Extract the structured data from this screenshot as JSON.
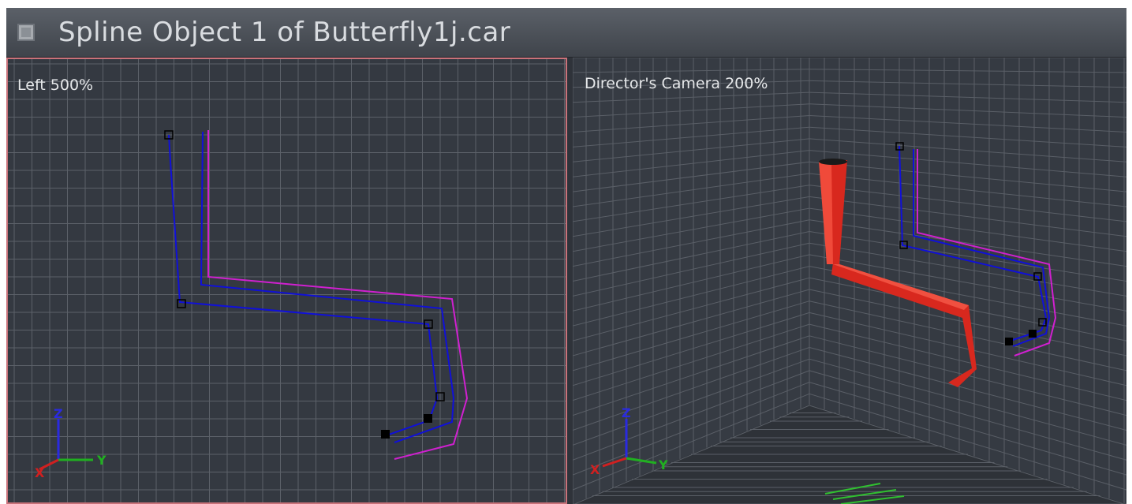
{
  "window": {
    "title": "Spline Object 1 of Butterfly1j.car",
    "icon": "window-menu-icon"
  },
  "viewports": [
    {
      "label": "Left 500%",
      "active": true,
      "axes": {
        "vertical": "Z",
        "horizontal": "Y",
        "depth": "X"
      }
    },
    {
      "label": "Director's Camera 200%",
      "active": false,
      "axes": {
        "vertical": "Z",
        "horizontal": "Y",
        "depth": "X"
      }
    }
  ],
  "colors": {
    "grid": "#5c6169",
    "spline_main": "#1010d8",
    "spline_magenta": "#d020d0",
    "tube": "#e02a20",
    "axis_z": "#2a2ae0",
    "axis_y": "#20b020",
    "axis_x": "#d02020",
    "active_border": "#c9727a"
  }
}
